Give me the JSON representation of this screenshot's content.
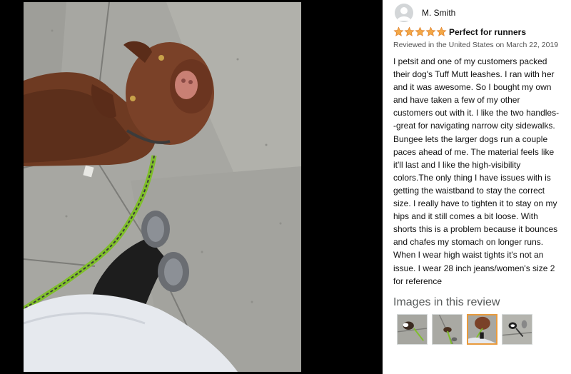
{
  "photo": {
    "description_icon": "dog-on-leash-photo"
  },
  "review": {
    "reviewer_name": "M. Smith",
    "rating": 5,
    "rating_max": 5,
    "title": "Perfect for runners",
    "date": "Reviewed in the United States on March 22, 2019",
    "body_lines": [
      "I petsit and one of my customers packed",
      "their dog's Tuff Mutt leashes. I ran with her",
      "and it was awesome. So I bought my own",
      "and have taken a few of my other",
      "customers out with it. I like the two handles-",
      "-great for navigating narrow city sidewalks.",
      "Bungee lets the larger dogs run a couple",
      "paces ahead of me. The material feels like",
      "it'll last and I like the high-visibility",
      "colors.The only thing I have issues with is",
      "getting the waistband to stay the correct",
      "size. I really have to tighten it to stay on my",
      "hips and it still comes a bit loose. With",
      "shorts this is a problem because it bounces",
      "and chafes my stomach on longer runs.",
      "When I wear high waist tights it's not an",
      "issue. I wear 28 inch jeans/women's size 2",
      "for reference"
    ]
  },
  "images_section": {
    "heading": "Images in this review",
    "selected_index": 2,
    "thumb_count": 4
  },
  "colors": {
    "star": "#f3a847",
    "star_outline": "#de7921",
    "selected_thumb_border": "#e89a3c"
  }
}
